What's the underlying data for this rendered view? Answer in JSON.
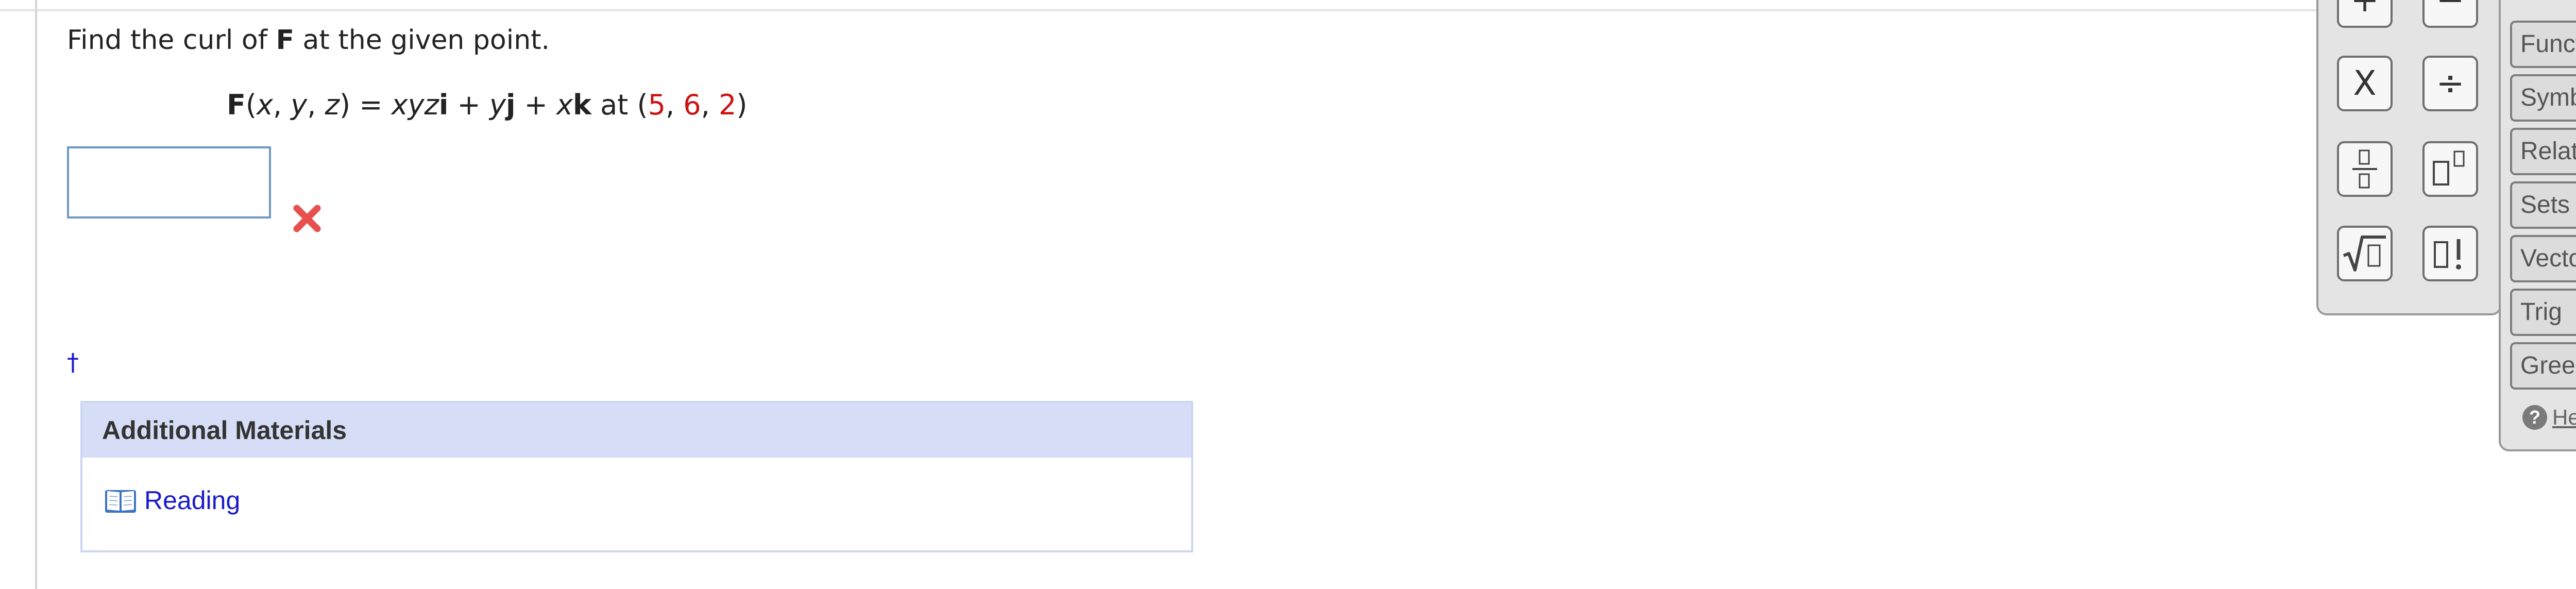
{
  "question": {
    "prefix": "Find the curl of ",
    "field": "F",
    "suffix": " at the given point."
  },
  "equation": {
    "lhs_field": "F",
    "open_paren": "(",
    "var_x": "x",
    "var_y": "y",
    "var_z": "z",
    "comma": ", ",
    "close_paren": ")",
    "equals": " = ",
    "term1": "xyz",
    "unit_i": "i",
    "plus": " + ",
    "term2": "y",
    "unit_j": "j",
    "term3": "x",
    "unit_k": "k",
    "at": " at ",
    "point_x": "5",
    "point_y": "6",
    "point_z": "2"
  },
  "answer": {
    "value": "",
    "status_icon": "red-x-icon"
  },
  "footnote_mark": "†",
  "materials": {
    "header": "Additional Materials",
    "links": [
      {
        "label": "Reading",
        "icon": "book-icon"
      }
    ]
  },
  "palette": {
    "keys": [
      {
        "name": "plus-key",
        "symbol": "+"
      },
      {
        "name": "minus-key",
        "symbol": "−"
      },
      {
        "name": "times-key",
        "symbol": "X"
      },
      {
        "name": "divide-key",
        "symbol": "÷"
      },
      {
        "name": "fraction-key",
        "icon": "fraction-icon"
      },
      {
        "name": "power-key",
        "icon": "power-icon"
      },
      {
        "name": "sqrt-key",
        "icon": "sqrt-icon"
      },
      {
        "name": "factorial-key",
        "icon": "factorial-icon"
      }
    ],
    "categories": [
      "Functions",
      "Symbols",
      "Relations",
      "Sets",
      "Vectors",
      "Trig",
      "Greek"
    ],
    "help": "Help"
  },
  "colors": {
    "link": "#1a1acc",
    "point_values": "#cc1111",
    "wrong_mark": "#e8504f",
    "materials_header_bg": "#d6ddf6",
    "input_border": "#6e98c4"
  }
}
